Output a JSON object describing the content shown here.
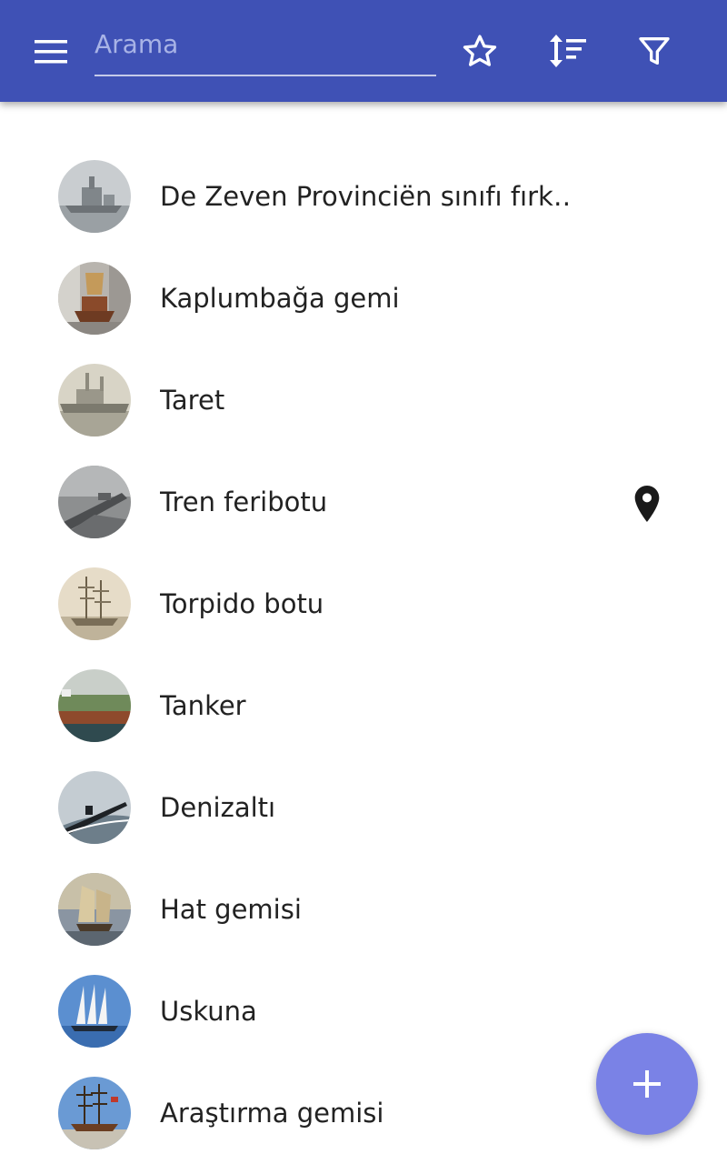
{
  "search": {
    "placeholder": "Arama",
    "value": ""
  },
  "toolbar": {
    "menu_icon": "menu-icon",
    "favorites_icon": "star-outline-icon",
    "sort_icon": "sort-icon",
    "filter_icon": "filter-icon"
  },
  "items": [
    {
      "label": "De Zeven Provinciën sınıfı fırk…"
    },
    {
      "label": "Kaplumbağa gemi"
    },
    {
      "label": "Taret"
    },
    {
      "label": "Tren feribotu",
      "has_location": true
    },
    {
      "label": "Torpido botu"
    },
    {
      "label": "Tanker"
    },
    {
      "label": "Denizaltı"
    },
    {
      "label": "Hat gemisi"
    },
    {
      "label": "Uskuna"
    },
    {
      "label": "Araştırma gemisi"
    }
  ],
  "fab": {
    "icon": "plus-icon"
  },
  "colors": {
    "app_bar": "#3f51b5",
    "fab": "#7a82e6",
    "text": "#222222"
  }
}
